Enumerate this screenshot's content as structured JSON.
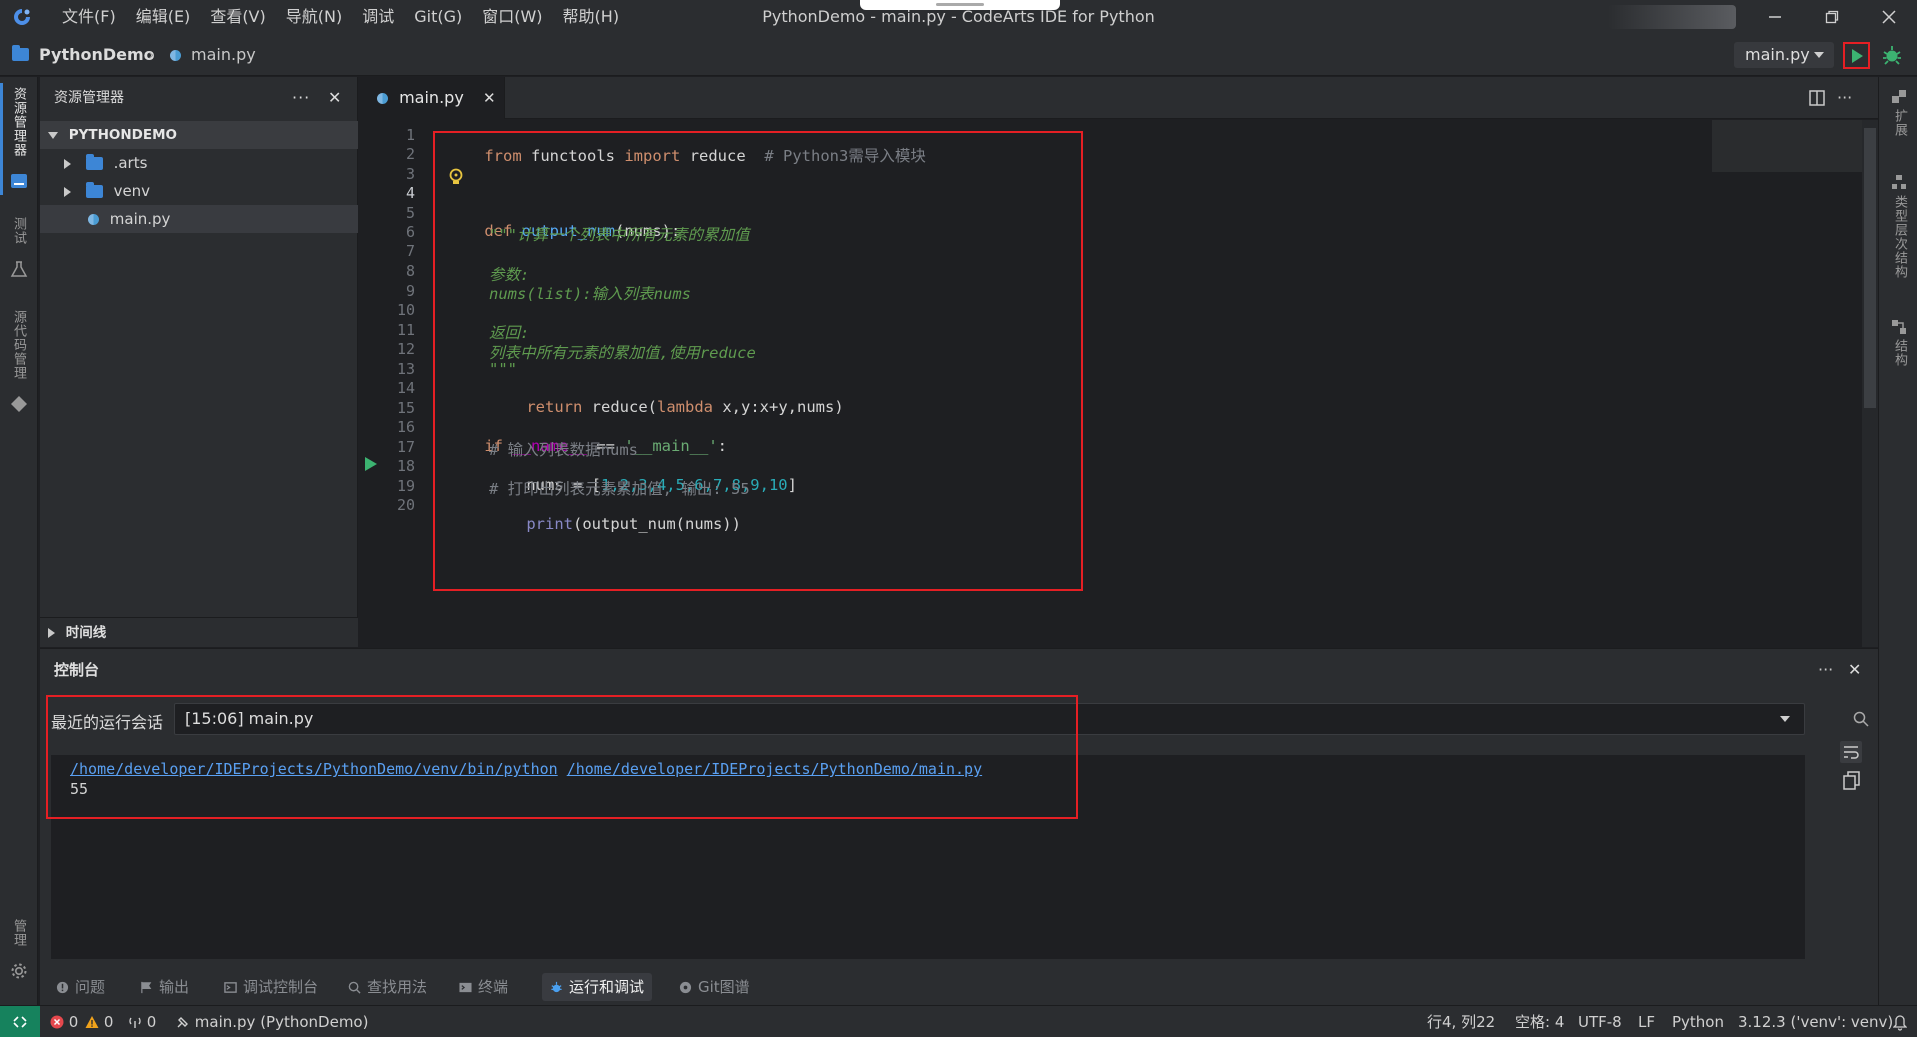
{
  "window": {
    "title": "PythonDemo - main.py - CodeArts IDE for Python",
    "menu": [
      "文件(F)",
      "编辑(E)",
      "查看(V)",
      "导航(N)",
      "调试",
      "Git(G)",
      "窗口(W)",
      "帮助(H)"
    ]
  },
  "breadcrumb": {
    "project": "PythonDemo",
    "file": "main.py"
  },
  "run_config": {
    "selected": "main.py"
  },
  "activity_left": {
    "explorer": "资源管理器",
    "test": "测试",
    "code_check": "源代码管理",
    "manage": "管理"
  },
  "activity_right": {
    "extensions": "扩展",
    "type_hierarchy": "类型层次结构",
    "structure": "结构"
  },
  "explorer": {
    "title": "资源管理器",
    "section": "PYTHONDEMO",
    "items": [
      {
        "label": ".arts",
        "kind": "folder"
      },
      {
        "label": "venv",
        "kind": "folder"
      },
      {
        "label": "main.py",
        "kind": "python-file"
      }
    ],
    "timeline": "时间线"
  },
  "editor": {
    "tab": "main.py",
    "line_numbers": [
      "1",
      "2",
      "3",
      "4",
      "5",
      "6",
      "7",
      "8",
      "9",
      "10",
      "11",
      "12",
      "13",
      "14",
      "15",
      "16",
      "17",
      "18",
      "19",
      "20"
    ],
    "current_line": 4,
    "code": {
      "l2": {
        "from": "from",
        "mod": "functools",
        "imp": "import",
        "name": "reduce",
        "comment": "# Python3需导入模块"
      },
      "l4": {
        "def": "def",
        "fn": "output_num",
        "rest": "(nums):"
      },
      "l5": "\"\"\"计算一个列表中所有元素的累加值",
      "l7": "参数:",
      "l8": "nums(list):输入列表nums",
      "l10": "返回:",
      "l11": "列表中所有元素的累加值,使用reduce",
      "l12": "\"\"\"",
      "l13": {
        "ret": "return",
        "fn": "reduce",
        "lam": "lambda",
        "rest": " x,y:x+y,nums)"
      },
      "l15": {
        "kw": "if",
        "dunder": "__name__",
        "op": " == ",
        "str": "'__main__'",
        "colon": ":"
      },
      "l16": "# 输入列表数据nums",
      "l17": {
        "lhs": "nums = [",
        "nums": "1,2,3,4,5,6,7,8,9,10",
        "rhs": "]"
      },
      "l18": "# 打印出列表元素累加值, 输出: 55",
      "l19": {
        "fn": "print",
        "rest": "(output_num(nums))"
      }
    }
  },
  "console": {
    "title": "控制台",
    "session_label": "最近的运行会话",
    "session_value": "[15:06] main.py",
    "output_interpreter": "/home/developer/IDEProjects/PythonDemo/venv/bin/python",
    "output_script": "/home/developer/IDEProjects/PythonDemo/main.py",
    "output_result": "55"
  },
  "panel_tabs": [
    "问题",
    "输出",
    "调试控制台",
    "查找用法",
    "终端",
    "运行和调试",
    "Git图谱"
  ],
  "panel_active": "运行和调试",
  "status": {
    "errors": "0",
    "warnings": "0",
    "ports": "0",
    "interpreter_target": "main.py (PythonDemo)",
    "position": "行4, 列22",
    "indent": "空格: 4",
    "encoding": "UTF-8",
    "eol": "LF",
    "language": "Python",
    "interpreter": "3.12.3 ('venv': venv)"
  },
  "colors": {
    "highlight_border": "#e51f24",
    "run_green": "#3cb371",
    "accent_blue": "#3d86d6"
  }
}
